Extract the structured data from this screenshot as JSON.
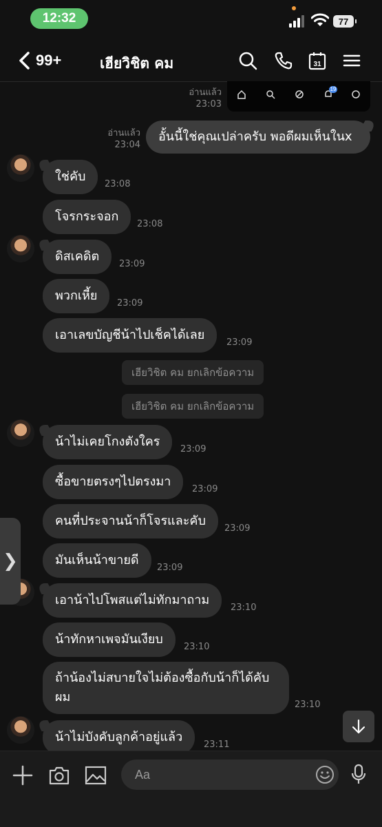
{
  "status_bar": {
    "time": "12:32",
    "battery": "77"
  },
  "header": {
    "back_count": "99+",
    "contact_name": "เฮียวิชิต คม"
  },
  "preview_strip": {
    "badge": "19"
  },
  "messages": [
    {
      "type": "sent",
      "read": "อ่านแล้ว",
      "time": "23:03"
    },
    {
      "type": "sent",
      "text": "อั้นนี้ใช่คุณเปล่าครับ พอดีผมเห็นในx",
      "read": "อ่านแล้ว",
      "time": "23:04"
    },
    {
      "type": "received",
      "text": "ใช่คับ",
      "time": "23:08"
    },
    {
      "type": "received",
      "text": "โจรกระจอก",
      "time": "23:08"
    },
    {
      "type": "received",
      "text": "ดิสเคดิต",
      "time": "23:09"
    },
    {
      "type": "received",
      "text": "พวกเหี้ย",
      "time": "23:09"
    },
    {
      "type": "received",
      "text": "เอาเลขบัญชีน้าไปเช็คได้เลย",
      "time": "23:09"
    },
    {
      "type": "system",
      "text": "เฮียวิชิต คม ยกเลิกข้อความ"
    },
    {
      "type": "system",
      "text": "เฮียวิชิต คม ยกเลิกข้อความ"
    },
    {
      "type": "received",
      "text": "น้าไม่เคยโกงตังใคร",
      "time": "23:09"
    },
    {
      "type": "received",
      "text": "ซื้อขายตรงๆไปตรงมา",
      "time": "23:09"
    },
    {
      "type": "received",
      "text": "คนที่ประจานน้าก็โจรและคับ",
      "time": "23:09"
    },
    {
      "type": "received",
      "text": "มันเห็นน้าขายดี",
      "time": "23:09"
    },
    {
      "type": "received",
      "text": "เอาน้าไปโพสแต่ไม่ทักมาถาม",
      "time": "23:10"
    },
    {
      "type": "received",
      "text": "น้าทักหาเพจมันเงียบ",
      "time": "23:10"
    },
    {
      "type": "received",
      "text": "ถ้าน้องไม่สบายใจไม่ต้องซื้อกับน้าก็ได้คับ",
      "text2": "ผม",
      "time": "23:10"
    },
    {
      "type": "received",
      "text": "น้าไม่บังคับลูกค้าอยู่แล้ว",
      "time": "23:11"
    }
  ],
  "side_tab": {
    "glyph": "❯"
  },
  "composer": {
    "placeholder": "Aa"
  },
  "icons": [
    "chevron-left-icon",
    "search-icon",
    "phone-icon",
    "calendar-icon",
    "menu-icon",
    "plus-icon",
    "camera-icon",
    "image-icon",
    "emoji-icon",
    "microphone-icon",
    "arrow-down-icon"
  ],
  "calendar_day": "31",
  "colors": {
    "background": "#121212",
    "bubble": "#303030",
    "sent_bubble": "#3d3d3d",
    "time_pill": "#5ec46f"
  }
}
